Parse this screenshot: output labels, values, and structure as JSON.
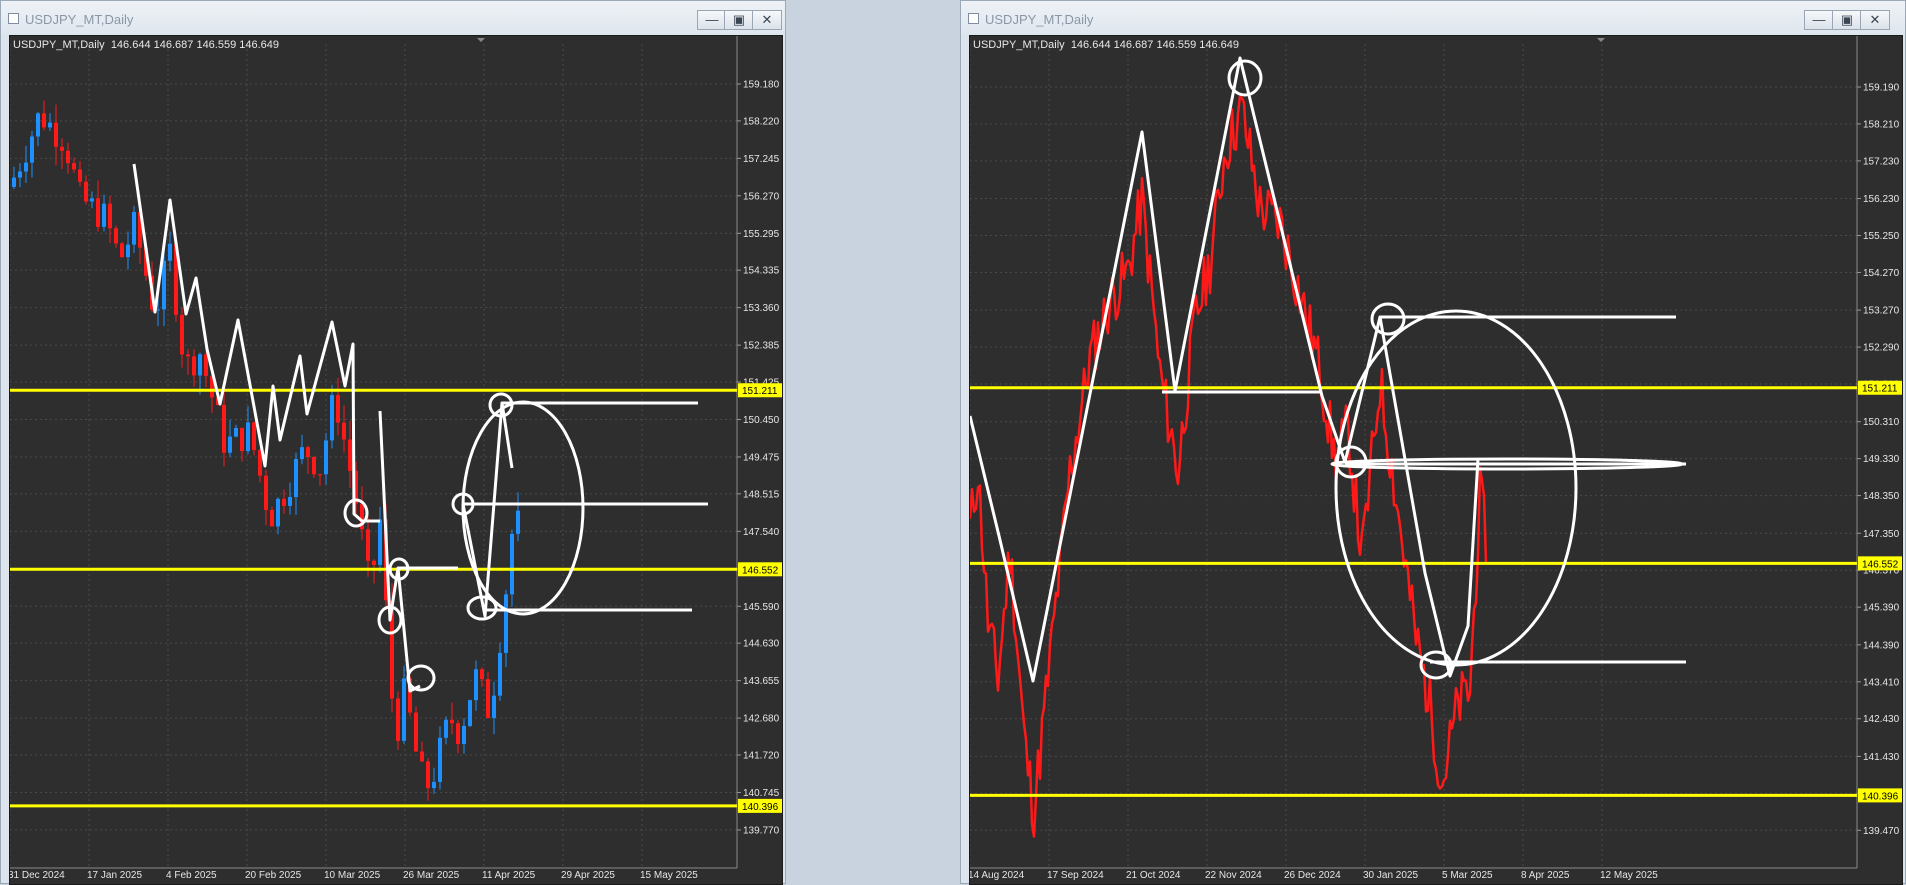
{
  "windows": [
    {
      "title": "USDJPY_MT,Daily",
      "info_symbol": "USDJPY_MT,Daily",
      "info_ohlc": "146.644 146.687 146.559 146.649",
      "buttons": {
        "minimize": "—",
        "maximize": "▣",
        "close": "✕"
      }
    },
    {
      "title": "USDJPY_MT,Daily",
      "info_symbol": "USDJPY_MT,Daily",
      "info_ohlc": "146.644 146.687 146.559 146.649",
      "buttons": {
        "minimize": "—",
        "maximize": "▣",
        "close": "✕"
      }
    }
  ],
  "chart_data": [
    {
      "type": "candlestick",
      "symbol": "USDJPY_MT",
      "timeframe": "Daily",
      "ylim": [
        139.3,
        159.7
      ],
      "y_ticks": [
        "159.180",
        "158.220",
        "157.245",
        "156.270",
        "155.295",
        "154.335",
        "153.360",
        "152.385",
        "151.425",
        "150.450",
        "149.475",
        "148.515",
        "147.540",
        "146.565",
        "145.590",
        "144.630",
        "143.655",
        "142.680",
        "141.720",
        "140.745",
        "139.770"
      ],
      "x_ticks": [
        "31 Dec 2024",
        "17 Jan 2025",
        "4 Feb 2025",
        "20 Feb 2025",
        "10 Mar 2025",
        "26 Mar 2025",
        "11 Apr 2025",
        "29 Apr 2025",
        "15 May 2025"
      ],
      "horizontal_levels": [
        {
          "value": 151.211,
          "label": "151.211",
          "color": "#ffff00"
        },
        {
          "value": 146.552,
          "label": "146.552",
          "color": "#ffff00"
        },
        {
          "value": 140.396,
          "label": "140.396",
          "color": "#ffff00"
        }
      ],
      "colors": {
        "bull": "#1e90ff",
        "bear": "#ff1a1a",
        "annotation": "#ffffff",
        "level": "#ffff00",
        "background": "#2e2e2e"
      }
    },
    {
      "type": "line",
      "symbol": "USDJPY_MT",
      "timeframe": "Daily",
      "ylim": [
        139.0,
        159.8
      ],
      "y_ticks": [
        "159.190",
        "158.210",
        "157.230",
        "156.230",
        "155.250",
        "154.270",
        "153.270",
        "152.290",
        "151.310",
        "150.310",
        "149.330",
        "148.350",
        "147.350",
        "146.370",
        "145.390",
        "144.390",
        "143.410",
        "142.430",
        "141.430",
        "140.450",
        "139.470"
      ],
      "x_ticks": [
        "14 Aug 2024",
        "17 Sep 2024",
        "21 Oct 2024",
        "22 Nov 2024",
        "26 Dec 2024",
        "30 Jan 2025",
        "5 Mar 2025",
        "8 Apr 2025",
        "12 May 2025"
      ],
      "horizontal_levels": [
        {
          "value": 151.211,
          "label": "151.211",
          "color": "#ffff00"
        },
        {
          "value": 146.552,
          "label": "146.552",
          "color": "#ffff00"
        },
        {
          "value": 140.396,
          "label": "140.396",
          "color": "#ffff00"
        }
      ],
      "colors": {
        "line": "#ff1a1a",
        "annotation": "#ffffff",
        "level": "#ffff00",
        "background": "#2e2e2e"
      }
    }
  ]
}
